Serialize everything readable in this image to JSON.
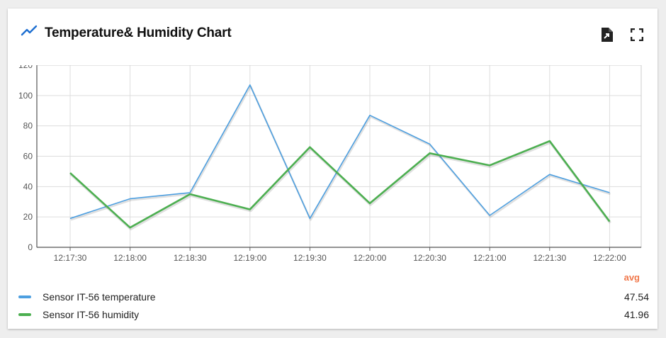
{
  "widget": {
    "title": "Temperature& Humidity Chart",
    "icons": {
      "title": "trending-up-icon",
      "export": "file-export-icon",
      "fullscreen": "fullscreen-icon"
    }
  },
  "legend": {
    "header": "avg",
    "items": [
      {
        "name": "Sensor IT-56 temperature",
        "avg": "47.54",
        "color": "#4d9fe0"
      },
      {
        "name": "Sensor IT-56 humidity",
        "avg": "41.96",
        "color": "#4caf50"
      }
    ]
  },
  "chart_data": {
    "type": "line",
    "x": [
      "12:17:30",
      "12:18:00",
      "12:18:30",
      "12:19:00",
      "12:19:30",
      "12:20:00",
      "12:20:30",
      "12:21:00",
      "12:21:30",
      "12:22:00"
    ],
    "xticks": [
      "12:17:30",
      "12:18:00",
      "12:18:30",
      "12:19:00",
      "12:19:30",
      "12:20:00",
      "12:20:30",
      "12:21:00",
      "12:21:30",
      "12:22:00"
    ],
    "yticks": [
      "0",
      "20",
      "40",
      "60",
      "80",
      "100",
      "120"
    ],
    "ylim": [
      0,
      120
    ],
    "grid": true,
    "series": [
      {
        "name": "Sensor IT-56 temperature",
        "color": "#4d9fe0",
        "values": [
          19,
          32,
          36,
          107,
          19,
          87,
          68,
          21,
          48,
          36
        ]
      },
      {
        "name": "Sensor IT-56 humidity",
        "color": "#4caf50",
        "values": [
          49,
          13,
          35,
          25,
          66,
          29,
          62,
          54,
          70,
          17
        ]
      }
    ]
  }
}
